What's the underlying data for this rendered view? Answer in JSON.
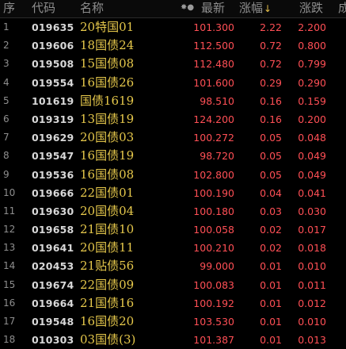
{
  "header": {
    "seq": "序",
    "code": "代码",
    "name": "名称",
    "icons": "✸●",
    "price": "最新",
    "pct": "涨幅",
    "pct_sort": "↓",
    "chg": "涨跌",
    "next": "成"
  },
  "colors": {
    "up": "#ff4f55",
    "name": "#e6c84b",
    "code": "#d8d8d8",
    "header": "#8e8e8e",
    "background": "#000000"
  },
  "rows": [
    {
      "seq": "1",
      "code": "019635",
      "name": "20特国01",
      "price": "101.300",
      "pct": "2.22",
      "chg": "2.200"
    },
    {
      "seq": "2",
      "code": "019606",
      "name": "18国债24",
      "price": "112.500",
      "pct": "0.72",
      "chg": "0.800"
    },
    {
      "seq": "3",
      "code": "019508",
      "name": "15国债08",
      "price": "112.480",
      "pct": "0.72",
      "chg": "0.799"
    },
    {
      "seq": "4",
      "code": "019554",
      "name": "16国债26",
      "price": "101.600",
      "pct": "0.29",
      "chg": "0.290"
    },
    {
      "seq": "5",
      "code": "101619",
      "name": "国债1619",
      "price": "98.510",
      "pct": "0.16",
      "chg": "0.159"
    },
    {
      "seq": "6",
      "code": "019319",
      "name": "13国债19",
      "price": "124.200",
      "pct": "0.16",
      "chg": "0.200"
    },
    {
      "seq": "7",
      "code": "019629",
      "name": "20国债03",
      "price": "100.272",
      "pct": "0.05",
      "chg": "0.048"
    },
    {
      "seq": "8",
      "code": "019547",
      "name": "16国债19",
      "price": "98.720",
      "pct": "0.05",
      "chg": "0.049"
    },
    {
      "seq": "9",
      "code": "019536",
      "name": "16国债08",
      "price": "102.800",
      "pct": "0.05",
      "chg": "0.049"
    },
    {
      "seq": "10",
      "code": "019666",
      "name": "22国债01",
      "price": "100.190",
      "pct": "0.04",
      "chg": "0.041"
    },
    {
      "seq": "11",
      "code": "019630",
      "name": "20国债04",
      "price": "100.180",
      "pct": "0.03",
      "chg": "0.030"
    },
    {
      "seq": "12",
      "code": "019658",
      "name": "21国债10",
      "price": "100.058",
      "pct": "0.02",
      "chg": "0.017"
    },
    {
      "seq": "13",
      "code": "019641",
      "name": "20国债11",
      "price": "100.210",
      "pct": "0.02",
      "chg": "0.018"
    },
    {
      "seq": "14",
      "code": "020453",
      "name": "21贴债56",
      "price": "99.000",
      "pct": "0.01",
      "chg": "0.010"
    },
    {
      "seq": "15",
      "code": "019674",
      "name": "22国债09",
      "price": "100.083",
      "pct": "0.01",
      "chg": "0.011"
    },
    {
      "seq": "16",
      "code": "019664",
      "name": "21国债16",
      "price": "100.192",
      "pct": "0.01",
      "chg": "0.012"
    },
    {
      "seq": "17",
      "code": "019548",
      "name": "16国债20",
      "price": "103.530",
      "pct": "0.01",
      "chg": "0.010"
    },
    {
      "seq": "18",
      "code": "010303",
      "name": "03国债(3)",
      "price": "101.387",
      "pct": "0.01",
      "chg": "0.013"
    }
  ]
}
